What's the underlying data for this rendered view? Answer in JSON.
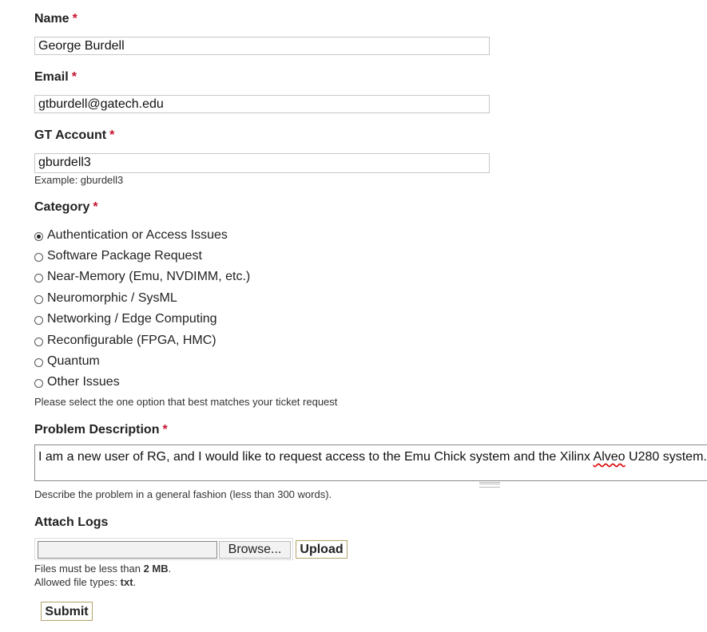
{
  "fields": {
    "name": {
      "label": "Name",
      "required_mark": "*",
      "value": "George Burdell"
    },
    "email": {
      "label": "Email",
      "required_mark": "*",
      "value": "gtburdell@gatech.edu"
    },
    "gt_account": {
      "label": "GT Account",
      "required_mark": "*",
      "value": "gburdell3",
      "help": "Example: gburdell3"
    }
  },
  "category": {
    "label": "Category",
    "required_mark": "*",
    "options": [
      {
        "label": "Authentication or Access Issues",
        "checked": true
      },
      {
        "label": "Software Package Request",
        "checked": false
      },
      {
        "label": "Near-Memory (Emu, NVDIMM, etc.)",
        "checked": false
      },
      {
        "label": "Neuromorphic / SysML",
        "checked": false
      },
      {
        "label": "Networking / Edge Computing",
        "checked": false
      },
      {
        "label": "Reconfigurable (FPGA, HMC)",
        "checked": false
      },
      {
        "label": "Quantum",
        "checked": false
      },
      {
        "label": "Other Issues",
        "checked": false
      }
    ],
    "help": "Please select the one option that best matches your ticket request"
  },
  "problem": {
    "label": "Problem Description",
    "required_mark": "*",
    "value_before": "I am a new user of RG, and I would like to request access to the Emu Chick system and the Xilinx ",
    "value_misspelled": "Alveo",
    "value_after": " U280 system.",
    "help": "Describe the problem in a general fashion (less than 300 words)."
  },
  "attach": {
    "label": "Attach Logs",
    "browse_label": "Browse...",
    "upload_label": "Upload",
    "size_prefix": "Files must be less than ",
    "size_value": "2 MB",
    "size_suffix": ".",
    "types_prefix": "Allowed file types: ",
    "types_value": "txt",
    "types_suffix": "."
  },
  "submit_label": "Submit"
}
